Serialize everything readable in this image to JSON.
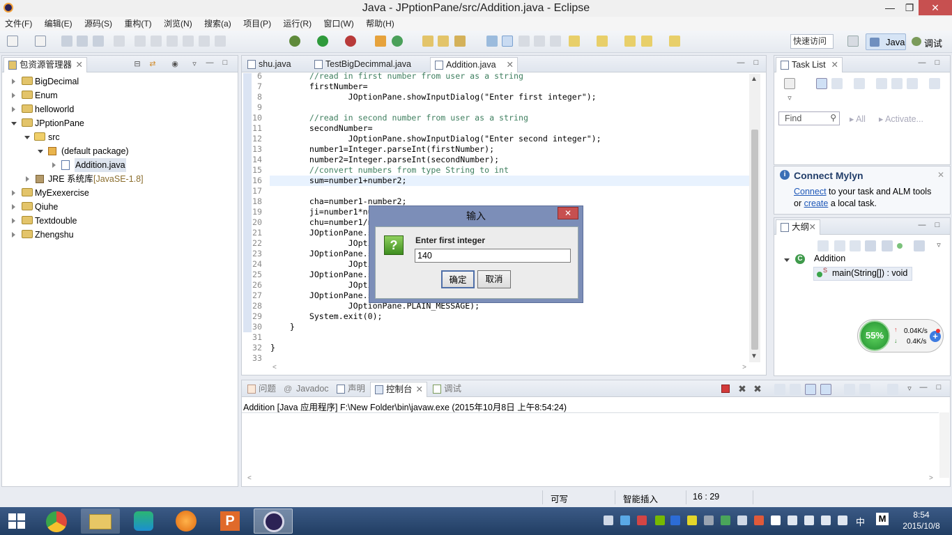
{
  "window": {
    "title": "Java - JPptionPane/src/Addition.java - Eclipse"
  },
  "menu": [
    "文件(F)",
    "编辑(E)",
    "源码(S)",
    "重构(T)",
    "浏览(N)",
    "搜索(a)",
    "项目(P)",
    "运行(R)",
    "窗口(W)",
    "帮助(H)"
  ],
  "toolbar": {
    "quick_access": "快速访问",
    "perspective_java": "Java",
    "perspective_debug": "调试"
  },
  "package_explorer": {
    "title": "包资源管理器",
    "items": [
      {
        "label": "BigDecimal"
      },
      {
        "label": "Enum"
      },
      {
        "label": "helloworld"
      },
      {
        "label": "JPptionPane"
      },
      {
        "label": "src"
      },
      {
        "label": "(default package)"
      },
      {
        "label": "Addition.java"
      },
      {
        "label": "JRE 系统库",
        "extra": "[JavaSE-1.8]"
      },
      {
        "label": "MyExexercise"
      },
      {
        "label": "Qiuhe"
      },
      {
        "label": "Textdouble"
      },
      {
        "label": "Zhengshu"
      }
    ]
  },
  "editor": {
    "tabs": [
      "shu.java",
      "TestBigDecimmal.java",
      "Addition.java"
    ],
    "lines": [
      {
        "n": "6",
        "t": "        //read in first number from user as a string"
      },
      {
        "n": "7",
        "t": "        firstNumber="
      },
      {
        "n": "8",
        "t": "                JOptionPane.showInputDialog(\"Enter first integer\");"
      },
      {
        "n": "9",
        "t": ""
      },
      {
        "n": "10",
        "t": "        //read in second number from user as a string"
      },
      {
        "n": "11",
        "t": "        secondNumber="
      },
      {
        "n": "12",
        "t": "                JOptionPane.showInputDialog(\"Enter second integer\");"
      },
      {
        "n": "13",
        "t": "        number1=Integer.parseInt(firstNumber);"
      },
      {
        "n": "14",
        "t": "        number2=Integer.parseInt(secondNumber);"
      },
      {
        "n": "15",
        "t": "        //convert numbers from type String to int"
      },
      {
        "n": "16",
        "t": "        sum=number1+number2;"
      },
      {
        "n": "17",
        "t": ""
      },
      {
        "n": "18",
        "t": "        cha=number1-number2;"
      },
      {
        "n": "19",
        "t": "        ji=number1*nu"
      },
      {
        "n": "20",
        "t": "        chu=number1/n"
      },
      {
        "n": "21",
        "t": "        JOptionPane.s                                   esults\","
      },
      {
        "n": "22",
        "t": "                JOpti"
      },
      {
        "n": "23",
        "t": "        JOptionPane.s                                   esults\","
      },
      {
        "n": "24",
        "t": "                JOpti"
      },
      {
        "n": "25",
        "t": "        JOptionPane.s                                   ults\","
      },
      {
        "n": "26",
        "t": "                JOpti"
      },
      {
        "n": "27",
        "t": "        JOptionPane.s                                   esults\","
      },
      {
        "n": "28",
        "t": "                JOptionPane.PLAIN_MESSAGE);"
      },
      {
        "n": "29",
        "t": "        System.exit(0);"
      },
      {
        "n": "30",
        "t": "    }"
      },
      {
        "n": "31",
        "t": ""
      },
      {
        "n": "32",
        "t": "}"
      },
      {
        "n": "33",
        "t": ""
      }
    ]
  },
  "dialog": {
    "title": "输入",
    "prompt": "Enter first integer",
    "value": "140",
    "ok": "确定",
    "cancel": "取消"
  },
  "task_list": {
    "title": "Task List",
    "find_placeholder": "Find",
    "all": "All",
    "activate": "Activate..."
  },
  "mylyn": {
    "title": "Connect Mylyn",
    "connect": "Connect",
    "text1": " to your task and ALM tools",
    "or": "or ",
    "create": "create",
    "text2": " a local task."
  },
  "outline": {
    "title": "大纲",
    "class": "Addition",
    "method": "main(String[]) : void"
  },
  "net_widget": {
    "percent": "55%",
    "up": "0.04K/s",
    "down": "0.4K/s"
  },
  "bottom_panel": {
    "tabs": [
      "问题",
      "Javadoc",
      "声明",
      "控制台",
      "调试"
    ],
    "console_line": "Addition [Java 应用程序] F:\\New Folder\\bin\\javaw.exe (2015年10月8日 上午8:54:24)"
  },
  "status_bar": {
    "writable": "可写",
    "insert_mode": "智能插入",
    "position": "16 : 29"
  },
  "taskbar": {
    "time": "8:54",
    "date": "2015/10/8",
    "ime": "中",
    "ime2": "M"
  }
}
